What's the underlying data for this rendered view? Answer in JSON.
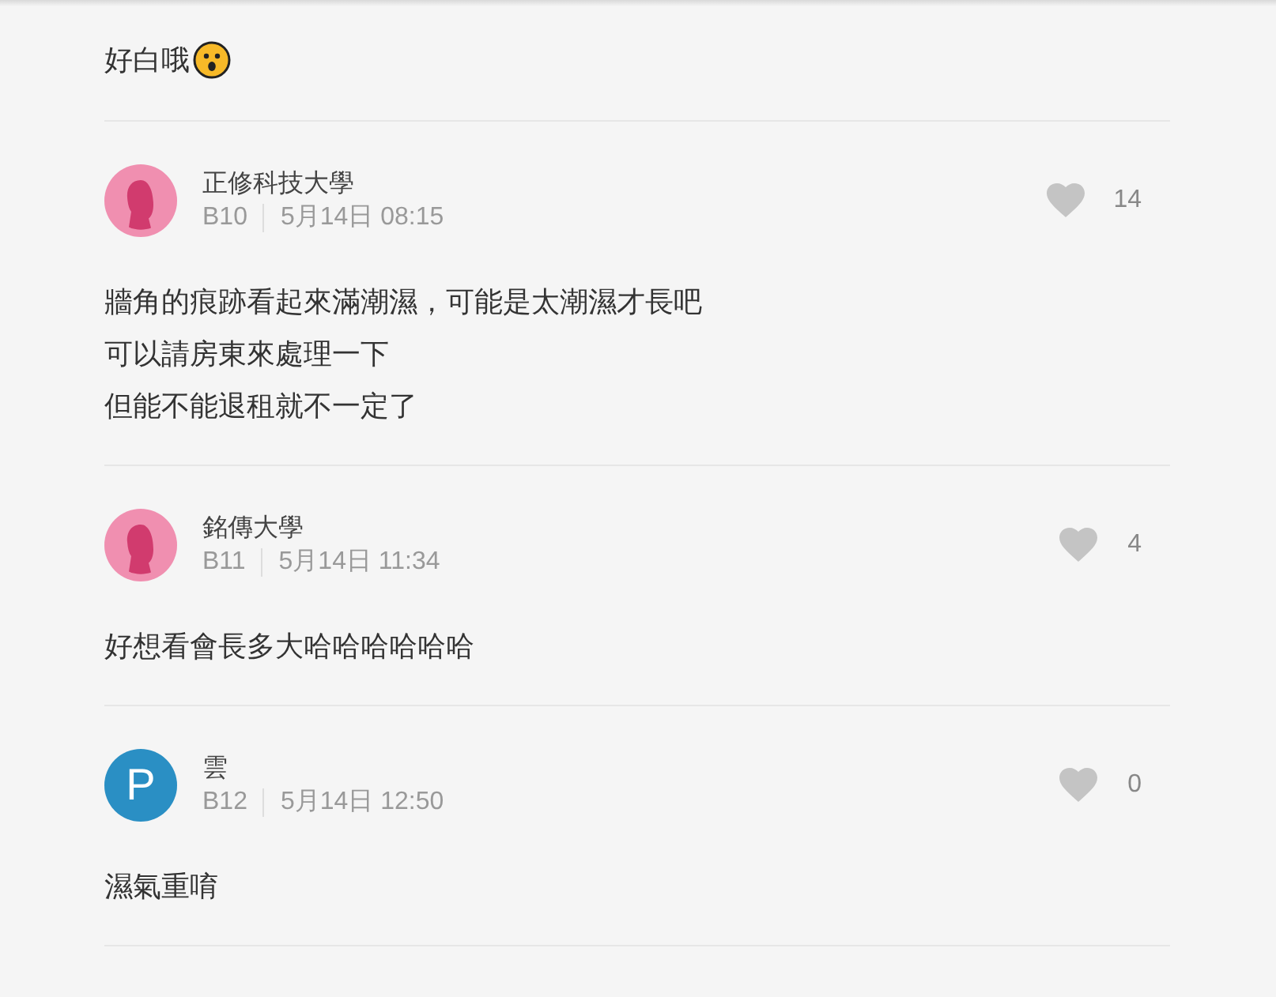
{
  "previous_comment": {
    "text": "好白哦"
  },
  "comments": [
    {
      "avatar": {
        "kind": "female"
      },
      "author": "正修科技大學",
      "floor": "B10",
      "time": "5月14日 08:15",
      "likes": "14",
      "body": [
        "牆角的痕跡看起來滿潮濕，可能是太潮濕才長吧",
        "可以請房東來處理一下",
        "但能不能退租就不一定了"
      ]
    },
    {
      "avatar": {
        "kind": "female"
      },
      "author": "銘傳大學",
      "floor": "B11",
      "time": "5月14日 11:34",
      "likes": "4",
      "body": [
        "好想看會長多大哈哈哈哈哈哈"
      ]
    },
    {
      "avatar": {
        "kind": "letter",
        "letter": "P"
      },
      "author": "雲",
      "floor": "B12",
      "time": "5月14日 12:50",
      "likes": "0",
      "body": [
        "濕氣重唷"
      ]
    }
  ]
}
